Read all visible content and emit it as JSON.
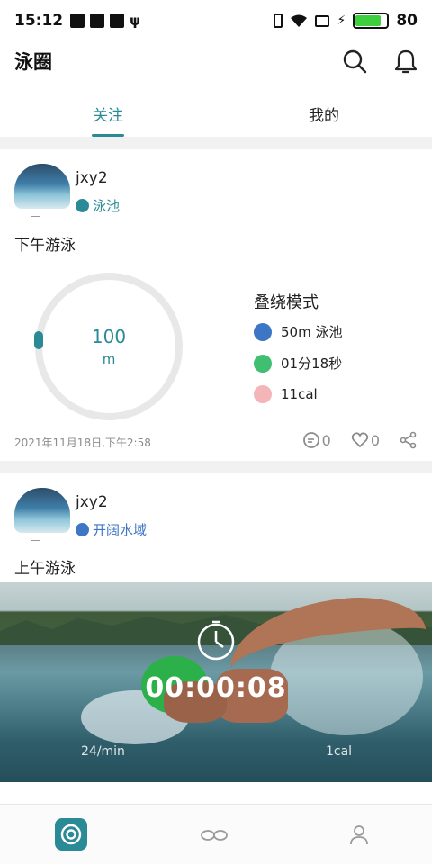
{
  "status_bar": {
    "time": "15:12",
    "battery": "80",
    "battery_level": 0.8
  },
  "header": {
    "title": "泳圈",
    "search_icon": "search-icon",
    "bell_icon": "bell-icon"
  },
  "tabs": [
    {
      "label": "关注",
      "active": true
    },
    {
      "label": "我的",
      "active": false
    }
  ],
  "posts": [
    {
      "username": "jxy2",
      "tag": "泳池",
      "title": "下午游泳",
      "ring": {
        "value": "100",
        "unit": "m"
      },
      "mode": "叠绕模式",
      "stats": [
        {
          "icon": "pool-icon",
          "text": "50m  泳池",
          "color": "#3d76c4"
        },
        {
          "icon": "clock-icon",
          "text": "01分18秒",
          "color": "#3fbf6f"
        },
        {
          "icon": "flame-icon",
          "text": "11cal",
          "color": "#f3b5b8"
        }
      ],
      "timestamp": "2021年11月18日,下午2:58",
      "comments": "0",
      "likes": "0"
    },
    {
      "username": "jxy2",
      "tag": "开阔水域",
      "title": "上午游泳",
      "photo": {
        "timer": "00:00:08",
        "stroke_rate": "24/min",
        "calories": "1cal"
      }
    }
  ],
  "colors": {
    "accent": "#2a8a95",
    "background_gap": "#f1f1f1"
  },
  "bottom_nav": [
    "home-icon",
    "goggles-icon",
    "profile-icon"
  ]
}
